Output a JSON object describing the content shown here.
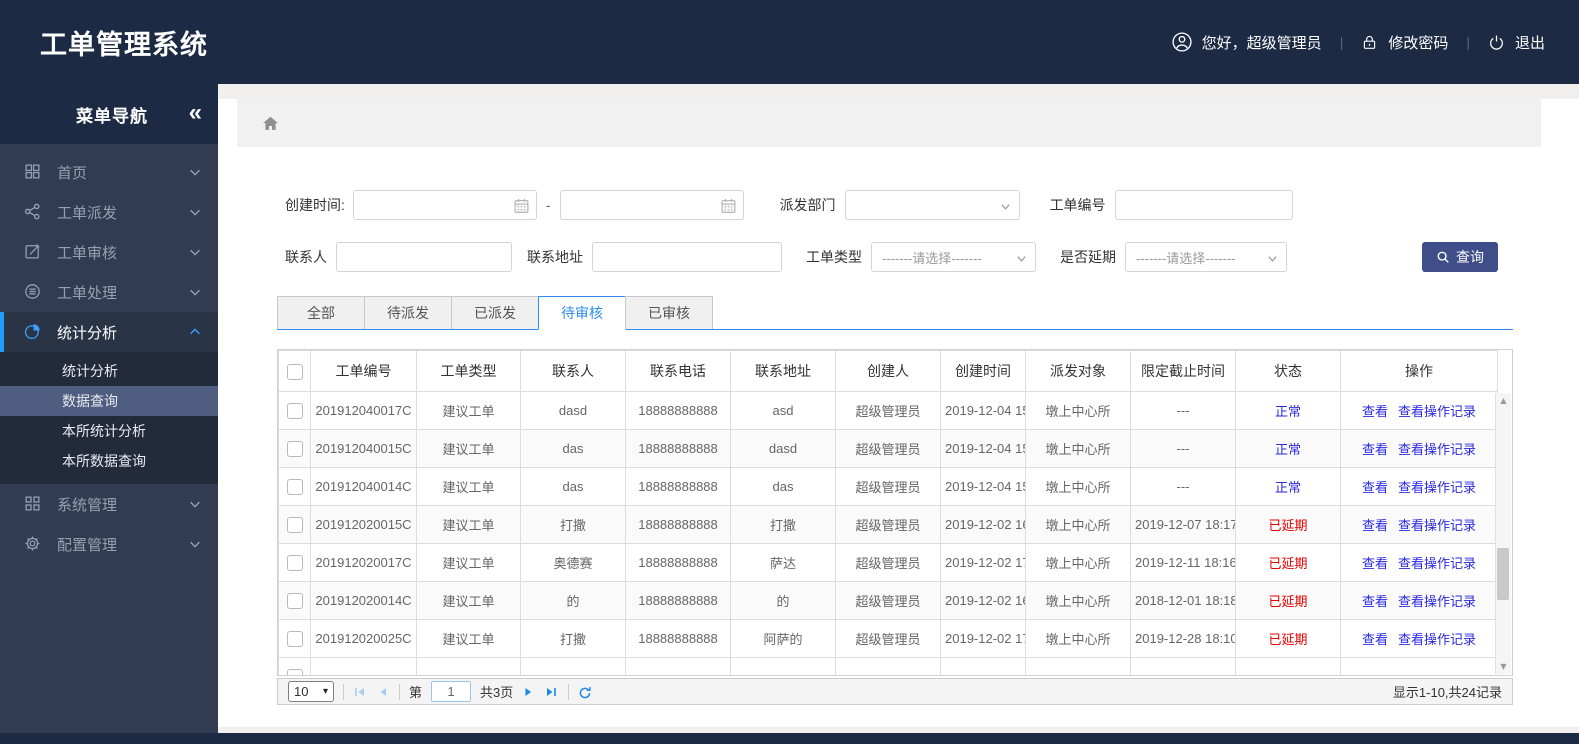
{
  "app": {
    "title": "工单管理系统"
  },
  "header": {
    "greeting": "您好，超级管理员",
    "change_password": "修改密码",
    "logout": "退出",
    "user_icon": "user-circle-icon",
    "lock_icon": "lock-icon",
    "power_icon": "power-icon"
  },
  "sidebar": {
    "title": "菜单导航",
    "collapse_icon": "chevron-double-left-icon",
    "items": [
      {
        "key": "home",
        "icon": "grid-icon",
        "label": "首页"
      },
      {
        "key": "dispatch",
        "icon": "share-icon",
        "label": "工单派发"
      },
      {
        "key": "review",
        "icon": "edit-icon",
        "label": "工单审核"
      },
      {
        "key": "process",
        "icon": "process-icon",
        "label": "工单处理"
      },
      {
        "key": "stats",
        "icon": "pie-icon",
        "label": "统计分析",
        "active": true,
        "children": [
          {
            "key": "stats-analysis",
            "label": "统计分析"
          },
          {
            "key": "data-query",
            "label": "数据查询",
            "selected": true
          },
          {
            "key": "branch-stats",
            "label": "本所统计分析"
          },
          {
            "key": "branch-data-query",
            "label": "本所数据查询"
          }
        ]
      },
      {
        "key": "system",
        "icon": "modules-icon",
        "label": "系统管理"
      },
      {
        "key": "config",
        "icon": "gear-icon",
        "label": "配置管理"
      }
    ]
  },
  "breadcrumb": {
    "home_icon": "home-icon"
  },
  "filters": {
    "created_label": "创建时间:",
    "range_sep": "-",
    "dept_label": "派发部门",
    "order_no_label": "工单编号",
    "contact_label": "联系人",
    "address_label": "联系地址",
    "type_label": "工单类型",
    "type_value": "-------请选择-------",
    "delay_label": "是否延期",
    "delay_value": "-------请选择-------",
    "search_label": "查询"
  },
  "tabs": [
    {
      "key": "all",
      "label": "全部"
    },
    {
      "key": "pending-dispatch",
      "label": "待派发"
    },
    {
      "key": "dispatched",
      "label": "已派发"
    },
    {
      "key": "pending-review",
      "label": "待审核",
      "active": true
    },
    {
      "key": "reviewed",
      "label": "已审核"
    }
  ],
  "table": {
    "columns": [
      "工单编号",
      "工单类型",
      "联系人",
      "联系电话",
      "联系地址",
      "创建人",
      "创建时间",
      "派发对象",
      "限定截止时间",
      "状态",
      "操作"
    ],
    "action_view": "查看",
    "action_log": "查看操作记录",
    "rows": [
      {
        "order_no": "201912040017C",
        "type": "建议工单",
        "contact": "dasd",
        "phone": "18888888888",
        "address": "asd",
        "creator": "超级管理员",
        "created": "2019-12-04 15",
        "target": "墩上中心所",
        "deadline": "---",
        "status": "正常",
        "status_type": "normal"
      },
      {
        "order_no": "201912040015C",
        "type": "建议工单",
        "contact": "das",
        "phone": "18888888888",
        "address": "dasd",
        "creator": "超级管理员",
        "created": "2019-12-04 15",
        "target": "墩上中心所",
        "deadline": "---",
        "status": "正常",
        "status_type": "normal"
      },
      {
        "order_no": "201912040014C",
        "type": "建议工单",
        "contact": "das",
        "phone": "18888888888",
        "address": "das",
        "creator": "超级管理员",
        "created": "2019-12-04 15",
        "target": "墩上中心所",
        "deadline": "---",
        "status": "正常",
        "status_type": "normal"
      },
      {
        "order_no": "201912020015C",
        "type": "建议工单",
        "contact": "打撒",
        "phone": "18888888888",
        "address": "打撒",
        "creator": "超级管理员",
        "created": "2019-12-02 16",
        "target": "墩上中心所",
        "deadline": "2019-12-07 18:17",
        "status": "已延期",
        "status_type": "delayed"
      },
      {
        "order_no": "201912020017C",
        "type": "建议工单",
        "contact": "奥德赛",
        "phone": "18888888888",
        "address": "萨达",
        "creator": "超级管理员",
        "created": "2019-12-02 17",
        "target": "墩上中心所",
        "deadline": "2019-12-11 18:16",
        "status": "已延期",
        "status_type": "delayed"
      },
      {
        "order_no": "201912020014C",
        "type": "建议工单",
        "contact": "的",
        "phone": "18888888888",
        "address": "的",
        "creator": "超级管理员",
        "created": "2019-12-02 16",
        "target": "墩上中心所",
        "deadline": "2018-12-01 18:18",
        "status": "已延期",
        "status_type": "delayed"
      },
      {
        "order_no": "201912020025C",
        "type": "建议工单",
        "contact": "打撒",
        "phone": "18888888888",
        "address": "阿萨的",
        "creator": "超级管理员",
        "created": "2019-12-02 17",
        "target": "墩上中心所",
        "deadline": "2019-12-28 18:10",
        "status": "已延期",
        "status_type": "delayed"
      }
    ]
  },
  "pagination": {
    "page_size": "10",
    "page_label": "第",
    "current_page": "1",
    "total_pages": "共3页",
    "summary": "显示1-10,共24记录"
  },
  "colors": {
    "accent": "#2d8cf0",
    "link": "#2a2ae0",
    "danger": "#e60000",
    "button": "#3f4e88",
    "header_bg": "#1d2a44",
    "sidebar_bg": "#313c52"
  }
}
